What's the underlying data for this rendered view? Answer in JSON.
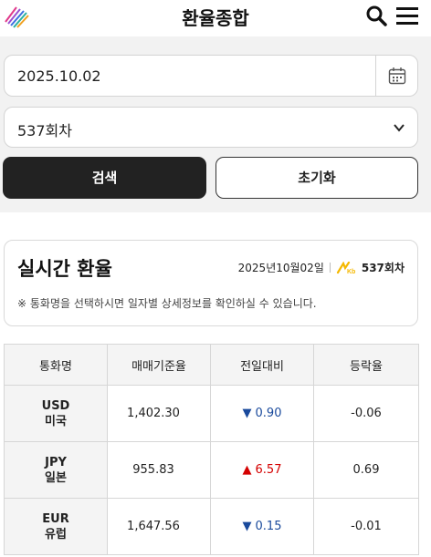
{
  "header": {
    "title": "환율종합",
    "logo_icon": "stripe-logo-icon",
    "search_icon": "search-icon",
    "menu_icon": "hamburger-menu-icon"
  },
  "filter": {
    "date_value": "2025.10.02",
    "calendar_icon": "calendar-icon",
    "round_value": "537회차",
    "search_label": "검색",
    "reset_label": "초기화"
  },
  "realtime": {
    "title": "실시간 환율",
    "date": "2025년10월02일",
    "round": "537회차",
    "note": "※ 통화명을 선택하시면 일자별 상세정보를 확인하실 수 있습니다."
  },
  "table": {
    "headers": [
      "통화명",
      "매매기준율",
      "전일대비",
      "등락율"
    ],
    "rows": [
      {
        "code": "USD",
        "name": "미국",
        "rate": "1,402.30",
        "change": "0.90",
        "direction": "down",
        "pct": "-0.06"
      },
      {
        "code": "JPY",
        "name": "일본",
        "rate": "955.83",
        "change": "6.57",
        "direction": "up",
        "pct": "0.69"
      },
      {
        "code": "EUR",
        "name": "유럽",
        "rate": "1,647.56",
        "change": "0.15",
        "direction": "down",
        "pct": "-0.01"
      }
    ]
  },
  "colors": {
    "down": "#1a4a9c",
    "up": "#d40000",
    "button_dark": "#222222",
    "kb_yellow": "#f5b800"
  }
}
